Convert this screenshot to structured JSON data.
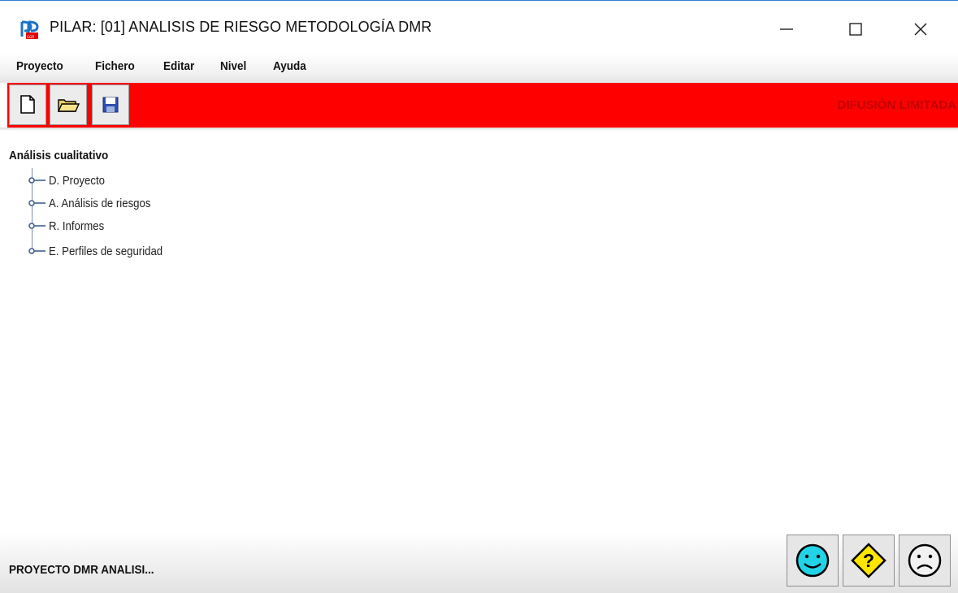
{
  "window": {
    "title": "PILAR: [01] ANALISIS DE RIESGO METODOLOGÍA DMR",
    "controls": [
      "minimize-icon",
      "maximize-icon",
      "close-icon"
    ]
  },
  "menu": {
    "items": [
      {
        "label": "Proyecto"
      },
      {
        "label": "Fichero"
      },
      {
        "label": "Editar"
      },
      {
        "label": "Nivel"
      },
      {
        "label": "Ayuda"
      }
    ]
  },
  "toolbar": {
    "buttons": [
      "new-document-icon",
      "open-folder-icon",
      "save-disk-icon"
    ],
    "classification": "DIFUSIÓN LIMITADA",
    "background_color": "#ff0000"
  },
  "tree": {
    "root": "Análisis cualitativo",
    "items": [
      {
        "label": "D. Proyecto"
      },
      {
        "label": "A. Análisis de riesgos"
      },
      {
        "label": "R. Informes"
      },
      {
        "label": "E. Perfiles de seguridad"
      }
    ]
  },
  "status": {
    "text": "PROYECTO DMR ANALISI...",
    "buttons": [
      "happy-face-icon",
      "question-diamond-icon",
      "sad-face-icon"
    ]
  }
}
